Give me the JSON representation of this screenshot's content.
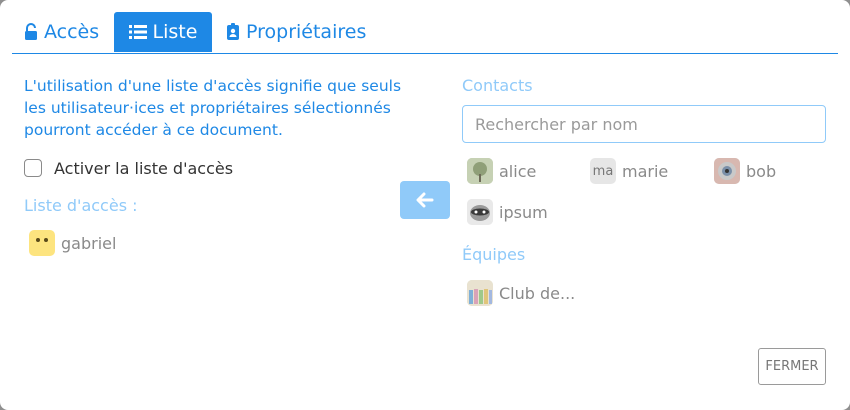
{
  "tabs": {
    "acces": "Accès",
    "liste": "Liste",
    "proprietaires": "Propriétaires"
  },
  "left": {
    "description": "L'utilisation d'une liste d'accès signifie que seuls les utilisateur·ices et propriétaires sélectionnés pourront accéder à ce document.",
    "checkbox_label": "Activer la liste d'accès",
    "list_label": "Liste d'accès :",
    "members": [
      {
        "name": "gabriel"
      }
    ]
  },
  "right": {
    "contacts_label": "Contacts",
    "search_placeholder": "Rechercher par nom",
    "contacts": [
      {
        "name": "alice"
      },
      {
        "name": "marie",
        "initials": "ma"
      },
      {
        "name": "bob"
      },
      {
        "name": "ipsum"
      }
    ],
    "teams_label": "Équipes",
    "teams": [
      {
        "name": "Club de..."
      }
    ]
  },
  "footer": {
    "close_label": "FERMER"
  },
  "colors": {
    "accent": "#1e88e5",
    "accent_light": "#90caf9"
  }
}
